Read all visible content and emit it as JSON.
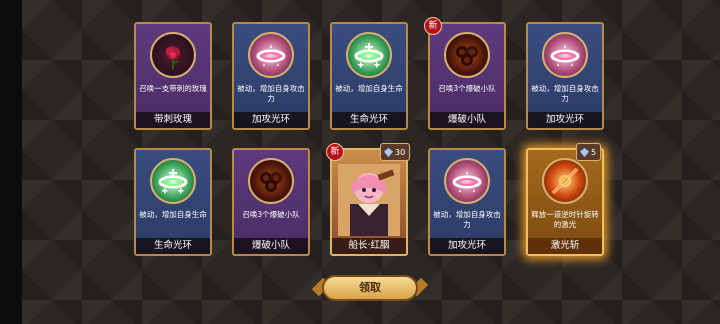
{
  "row1": [
    {
      "desc": "召唤一支带刺的玫瑰",
      "name": "带刺玫瑰",
      "theme": "purple",
      "icon": "rose-icon"
    },
    {
      "desc": "被动，增加自身攻击力",
      "name": "加攻光环",
      "theme": "blue",
      "icon": "pink-halo-icon"
    },
    {
      "desc": "被动，增加自身生命",
      "name": "生命光环",
      "theme": "blue",
      "icon": "green-halo-icon"
    },
    {
      "desc": "召唤3个爆破小队",
      "name": "爆破小队",
      "theme": "purple",
      "icon": "bomb-icon",
      "new": "新"
    },
    {
      "desc": "被动，增加自身攻击力",
      "name": "加攻光环",
      "theme": "blue",
      "icon": "pink-halo-icon"
    }
  ],
  "row2": [
    {
      "desc": "被动，增加自身生命",
      "name": "生命光环",
      "theme": "blue",
      "icon": "green-halo-icon"
    },
    {
      "desc": "召唤3个爆破小队",
      "name": "爆破小队",
      "theme": "purple",
      "icon": "bomb-icon"
    },
    {
      "desc": "",
      "name": "船长·红胭",
      "theme": "hero",
      "icon": "hero-portrait",
      "new": "新",
      "count": "30"
    },
    {
      "desc": "被动，增加自身攻击力",
      "name": "加攻光环",
      "theme": "blue",
      "icon": "pink-halo-icon"
    },
    {
      "desc": "释放一道逆时针旋转的激光",
      "name": "激光斩",
      "theme": "gold",
      "icon": "laser-icon",
      "count": "5"
    }
  ],
  "claim_label": "领取"
}
